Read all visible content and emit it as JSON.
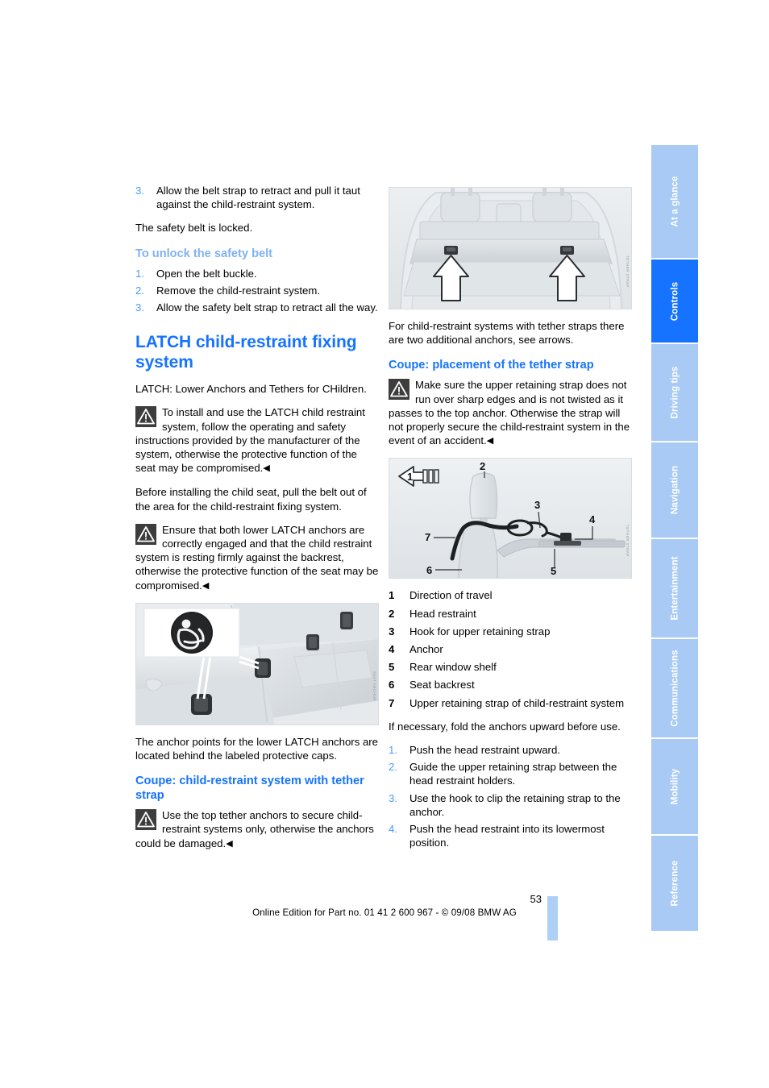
{
  "document": {
    "page_number": "53",
    "footer": "Online Edition for Part no. 01 41 2 600 967  - © 09/08 BMW AG"
  },
  "sidebar": {
    "tabs": [
      {
        "label": "At a glance",
        "active": false
      },
      {
        "label": "Controls",
        "active": true
      },
      {
        "label": "Driving tips",
        "active": false
      },
      {
        "label": "Navigation",
        "active": false
      },
      {
        "label": "Entertainment",
        "active": false
      },
      {
        "label": "Communications",
        "active": false
      },
      {
        "label": "Mobility",
        "active": false
      },
      {
        "label": "Reference",
        "active": false
      }
    ]
  },
  "left_column": {
    "step_3_num": "3.",
    "step_3_text": "Allow the belt strap to retract and pull it taut against the child-restraint system.",
    "locked_note": "The safety belt is locked.",
    "unlock_heading": "To unlock the safety belt",
    "unlock_steps": [
      {
        "num": "1.",
        "text": "Open the belt buckle."
      },
      {
        "num": "2.",
        "text": "Remove the child-restraint system."
      },
      {
        "num": "3.",
        "text": "Allow the safety belt strap to retract all the way."
      }
    ],
    "latch_heading": "LATCH child-restraint fixing system",
    "latch_intro": "LATCH: Lower Anchors and Tethers for CHildren.",
    "warning_1": "To install and use the LATCH child restraint system, follow the operating and safety instructions provided by the manufacturer of the system, otherwise the protective function of the seat may be compromised.",
    "before_install": "Before installing the child seat, pull the belt out of the area for the child-restraint fixing system.",
    "warning_2": "Ensure that both lower LATCH anchors are correctly engaged and that the child restraint system is resting firmly against the backrest, otherwise the protective function of the seat may be compromised.",
    "figure_anchor_caps_caption": "The anchor points for the lower LATCH anchors are located behind the labeled protective caps.",
    "coupe_tether_heading": "Coupe: child-restraint system with tether strap",
    "warning_3": "Use the top tether anchors to secure child-restraint systems only, otherwise the anchors could be damaged.",
    "figure_credit": "SEAT ANCHOR"
  },
  "right_column": {
    "figure_top_caption": "For child-restraint systems with tether straps there are two additional anchors, see arrows.",
    "placement_heading": "Coupe: placement of the tether strap",
    "warning_4": "Make sure the upper retaining strap does not run over sharp edges and is not twisted as it passes to the top anchor. Otherwise the strap will not properly secure the child-restraint system in the event of an accident.",
    "legend": [
      {
        "num": "1",
        "text": "Direction of travel"
      },
      {
        "num": "2",
        "text": "Head restraint"
      },
      {
        "num": "3",
        "text": "Hook for upper retaining strap"
      },
      {
        "num": "4",
        "text": "Anchor"
      },
      {
        "num": "5",
        "text": "Rear window shelf"
      },
      {
        "num": "6",
        "text": "Seat backrest"
      },
      {
        "num": "7",
        "text": "Upper retaining strap of child-restraint system"
      }
    ],
    "fold_note": "If necessary, fold the anchors upward before use.",
    "procedure": [
      {
        "num": "1.",
        "text": "Push the head restraint upward."
      },
      {
        "num": "2.",
        "text": "Guide the upper retaining strap between the head restraint holders."
      },
      {
        "num": "3.",
        "text": "Use the hook to clip the retaining strap to the anchor."
      },
      {
        "num": "4.",
        "text": "Push the head restraint into its lowermost position."
      }
    ],
    "diagram_labels": [
      "1",
      "2",
      "3",
      "4",
      "5",
      "6",
      "7"
    ],
    "figure_credit": "TETHER STRAP"
  },
  "colors": {
    "heading_blue": "#1673ff",
    "subheading_blue": "#7fb2f2",
    "list_number_blue": "#4a9bff",
    "tab_inactive": "#a8caf5",
    "tab_active": "#1673ff",
    "page_bar": "#aed0f7"
  },
  "end_mark": "◀"
}
